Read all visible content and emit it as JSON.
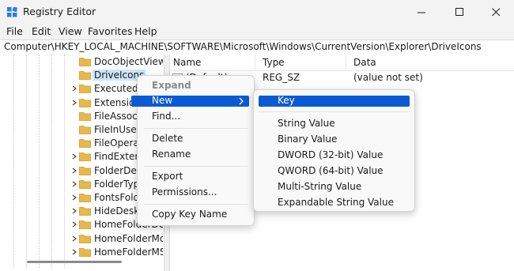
{
  "window": {
    "title": "Registry Editor",
    "controls": {
      "minimize": "minimize-icon",
      "maximize": "maximize-icon",
      "close": "close-icon"
    }
  },
  "menu": {
    "file": "File",
    "edit": "Edit",
    "view": "View",
    "favorites": "Favorites",
    "help": "Help"
  },
  "address": {
    "path": "Computer\\HKEY_LOCAL_MACHINE\\SOFTWARE\\Microsoft\\Windows\\CurrentVersion\\Explorer\\DriveIcons"
  },
  "tree": {
    "items": [
      {
        "label": "DocObjectView",
        "expandable": false,
        "selected": false
      },
      {
        "label": "DriveIcons",
        "expandable": false,
        "selected": true
      },
      {
        "label": "Executed",
        "expandable": true,
        "selected": false
      },
      {
        "label": "Extensions",
        "expandable": true,
        "selected": false
      },
      {
        "label": "FileAssociation",
        "expandable": false,
        "selected": false
      },
      {
        "label": "FileInUse",
        "expandable": false,
        "selected": false
      },
      {
        "label": "FileOperations",
        "expandable": false,
        "selected": false
      },
      {
        "label": "FindExtensions",
        "expandable": true,
        "selected": false
      },
      {
        "label": "FolderDescriptions",
        "expandable": true,
        "selected": false
      },
      {
        "label": "FolderTypes",
        "expandable": true,
        "selected": false
      },
      {
        "label": "FontsFolder",
        "expandable": true,
        "selected": false
      },
      {
        "label": "HideDesktopIcons",
        "expandable": true,
        "selected": false
      },
      {
        "label": "HomeFolderDesktop",
        "expandable": true,
        "selected": false
      },
      {
        "label": "HomeFolderMobile",
        "expandable": true,
        "selected": false
      },
      {
        "label": "HomeFolderMSGraph",
        "expandable": true,
        "selected": false
      }
    ]
  },
  "list": {
    "headers": {
      "name": "Name",
      "type": "Type",
      "data": "Data"
    },
    "rows": [
      {
        "name": "(Default)",
        "type": "REG_SZ",
        "data": "(value not set)"
      }
    ]
  },
  "context_menu": {
    "items": {
      "expand": "Expand",
      "new": "New",
      "find": "Find...",
      "delete": "Delete",
      "rename": "Rename",
      "export": "Export",
      "permissions": "Permissions...",
      "copy_key_name": "Copy Key Name"
    }
  },
  "submenu": {
    "items": {
      "key": "Key",
      "string_value": "String Value",
      "binary_value": "Binary Value",
      "dword_value": "DWORD (32-bit) Value",
      "qword_value": "QWORD (64-bit) Value",
      "multi_string_value": "Multi-String Value",
      "expandable_string_value": "Expandable String Value"
    }
  },
  "colors": {
    "highlight": "#0a5ad3",
    "folder": "#e8b94a",
    "selection": "#cce4f7"
  }
}
